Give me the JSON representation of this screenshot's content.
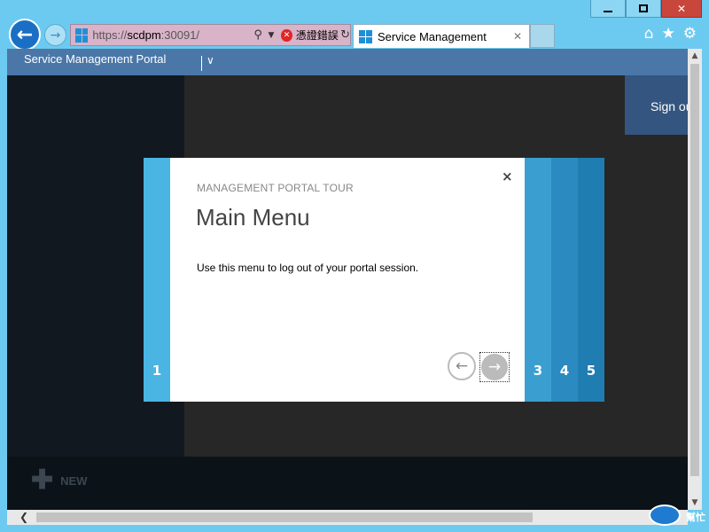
{
  "browser": {
    "address": {
      "url_prefix": "https://",
      "url_host": "scdpm",
      "url_suffix": ":30091/",
      "cert_error_label": "憑證錯誤"
    },
    "tab": {
      "title": "Service Management",
      "close_glyph": "✕"
    },
    "window_controls": {
      "close_glyph": "✕"
    },
    "nav": {
      "back_glyph": "←",
      "forward_glyph": "→"
    },
    "toolbar": {
      "home_glyph": "⌂",
      "favorites_glyph": "★",
      "settings_glyph": "⚙"
    }
  },
  "portal": {
    "header_title": "Service Management Portal",
    "header_chevron": "∨",
    "sign_out_label": "Sign out",
    "new_button": {
      "plus": "✚",
      "label": "NEW"
    }
  },
  "tour": {
    "eyebrow": "MANAGEMENT PORTAL TOUR",
    "heading": "Main Menu",
    "body": "Use this menu to log out of your portal session.",
    "close_glyph": "×",
    "prev_glyph": "←",
    "next_glyph": "→",
    "steps": [
      "1",
      "3",
      "4",
      "5"
    ]
  },
  "watermark": {
    "text": "幫忙"
  },
  "colors": {
    "portal_header": "#4a77a8",
    "tour_step_1": "#4ab4e2",
    "tour_step_3": "#3a9fd0",
    "tour_step_4": "#2b8ac0",
    "tour_step_5": "#1f7db2",
    "sign_out_tile": "#33557f"
  }
}
